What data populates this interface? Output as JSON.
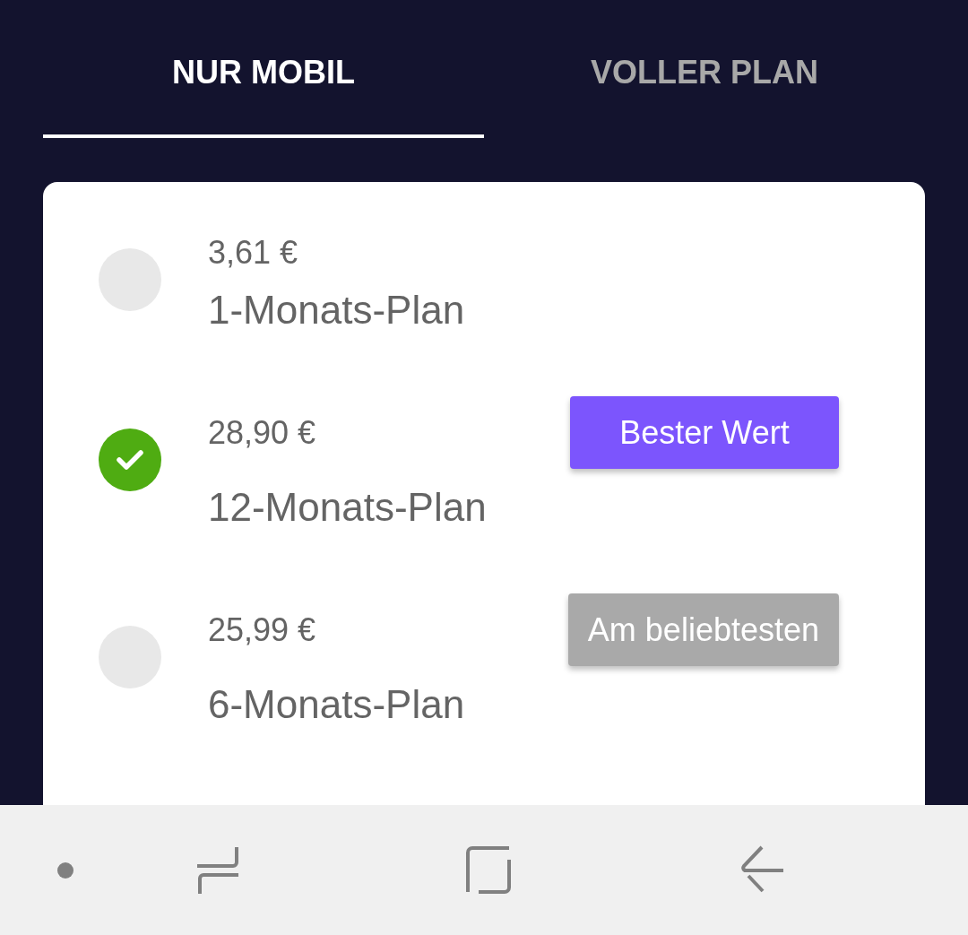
{
  "tabs": [
    {
      "label": "NUR MOBIL",
      "selected": true
    },
    {
      "label": "VOLLER PLAN",
      "selected": false
    }
  ],
  "plans": [
    {
      "price": "3,61 €",
      "name": "1-Monats-Plan",
      "selected": false
    },
    {
      "price": "28,90 €",
      "name": "12-Monats-Plan",
      "selected": true,
      "badge": {
        "label": "Bester Wert",
        "kind": "highlight"
      }
    },
    {
      "price": "25,99 €",
      "name": "6-Monats-Plan",
      "selected": false,
      "badge": {
        "label": "Am beliebtesten",
        "kind": "muted"
      }
    }
  ]
}
